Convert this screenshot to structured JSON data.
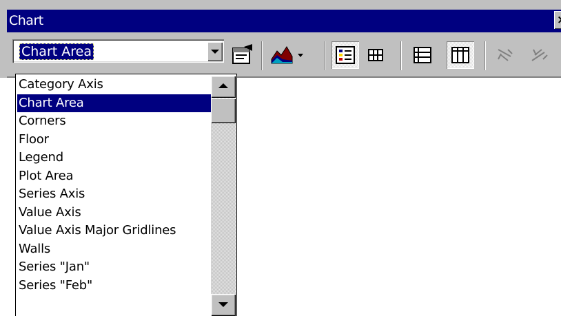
{
  "window": {
    "title": "Chart",
    "close_glyph": "×"
  },
  "toolbar": {
    "chart_objects": {
      "selected": "Chart Area"
    },
    "buttons": [
      {
        "name": "format-chart-area-icon"
      },
      {
        "name": "chart-type-icon"
      },
      {
        "name": "legend-icon"
      },
      {
        "name": "data-table-icon"
      },
      {
        "name": "by-row-icon"
      },
      {
        "name": "by-column-icon"
      },
      {
        "name": "angle-text-downward-icon"
      },
      {
        "name": "angle-text-upward-icon"
      }
    ]
  },
  "dropdown": {
    "items": [
      "Category Axis",
      "Chart Area",
      "Corners",
      "Floor",
      "Legend",
      "Plot Area",
      "Series Axis",
      "Value Axis",
      "Value Axis Major Gridlines",
      "Walls",
      "Series \"Jan\"",
      "Series \"Feb\""
    ],
    "selected_index": 1
  },
  "colors": {
    "titlebar": "#000080",
    "face": "#c0c0c0",
    "selection": "#000080"
  }
}
